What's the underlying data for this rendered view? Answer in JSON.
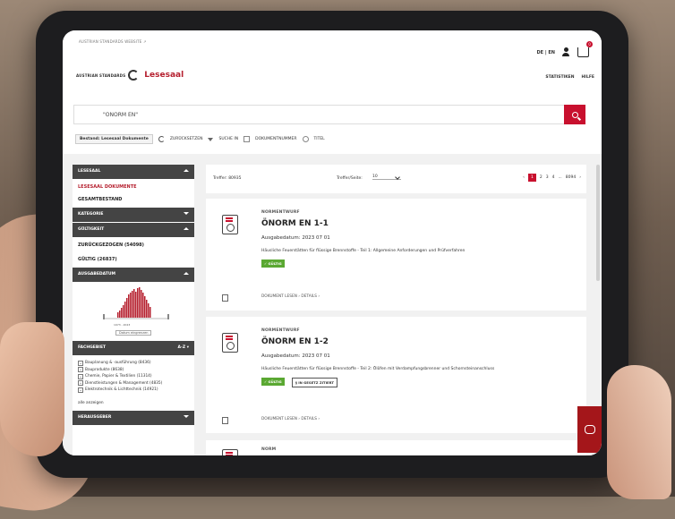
{
  "header": {
    "site_link": "AUSTRIAN STANDARDS WEBSITE ↗",
    "brand_logo": "AUSTRIAN STANDARDS",
    "brand_title": "Lesesaal",
    "lang": "DE | EN",
    "cart_count": "0",
    "nav": [
      "STATISTIKEN",
      "HILFE"
    ]
  },
  "search": {
    "value": "\"ÖNORM EN\""
  },
  "filters": {
    "bestand": "Bestand: Lesesaal Dokumente",
    "reset": "ZURÜCKSETZEN",
    "suche_in": "SUCHE IN",
    "dokumentnummer": "DOKUMENTNUMMER",
    "titel": "TITEL"
  },
  "sidebar": {
    "lesesaal_head": "LESESAAL",
    "lesesaal_items": [
      "LESESAAL DOKUMENTE",
      "GESAMTBESTAND"
    ],
    "kategorie_head": "KATEGORIE",
    "gueltigkeit_head": "GÜLTIGKEIT",
    "gueltigkeit_items": [
      "ZURÜCKGEZOGEN (54098)",
      "GÜLTIG (26837)"
    ],
    "ausgabedatum_head": "AUSGABEDATUM",
    "hist_years": "1973 - 2023",
    "hist_button": "Datum eingrenzen",
    "fachgebiet_head": "FACHGEBIET",
    "fachgebiet_sort": "A-Z ▾",
    "fachgebiet_items": [
      "Bauplanung & -ausführung (8436)",
      "Bauprodukte (8638)",
      "Chemie, Papier & Textilien (11314)",
      "Dienstleistungen & Management (4835)",
      "Elektrotechnik & Lichttechnik (14921)"
    ],
    "alle": "alle anzeigen",
    "herausgeber_head": "HERAUSGEBER"
  },
  "results": {
    "treffer": "Treffer: 80935",
    "perpage_label": "Treffer/Seite:",
    "perpage_value": "10",
    "pages": [
      "1",
      "2",
      "3",
      "4",
      "...",
      "8094"
    ]
  },
  "cards": [
    {
      "kind": "NORMENTWURF",
      "title": "ÖNORM EN 1-1",
      "date": "Ausgabedatum: 2023 07 01",
      "desc": "Häusliche Feuerstätten für flüssige Brennstoffe - Teil 1: Allgemeine Anforderungen und Prüfverfahren",
      "badge": "✓ GÜLTIG",
      "links": "DOKUMENT LESEN ›   DETAILS ›"
    },
    {
      "kind": "NORMENTWURF",
      "title": "ÖNORM EN 1-2",
      "date": "Ausgabedatum: 2023 07 01",
      "desc": "Häusliche Feuerstätten für flüssige Brennstoffe - Teil 2: Ölöfen mit Verdampfungsbrenner und Schornsteinanschluss",
      "badge": "✓ GÜLTIG",
      "badge2": "§ IN GESETZ ZITIERT",
      "links": "DOKUMENT LESEN ›   DETAILS ›"
    },
    {
      "kind": "NORM"
    }
  ],
  "colors": {
    "accent": "#c8102e",
    "sidebar_head": "#444444",
    "valid": "#5aa832"
  }
}
